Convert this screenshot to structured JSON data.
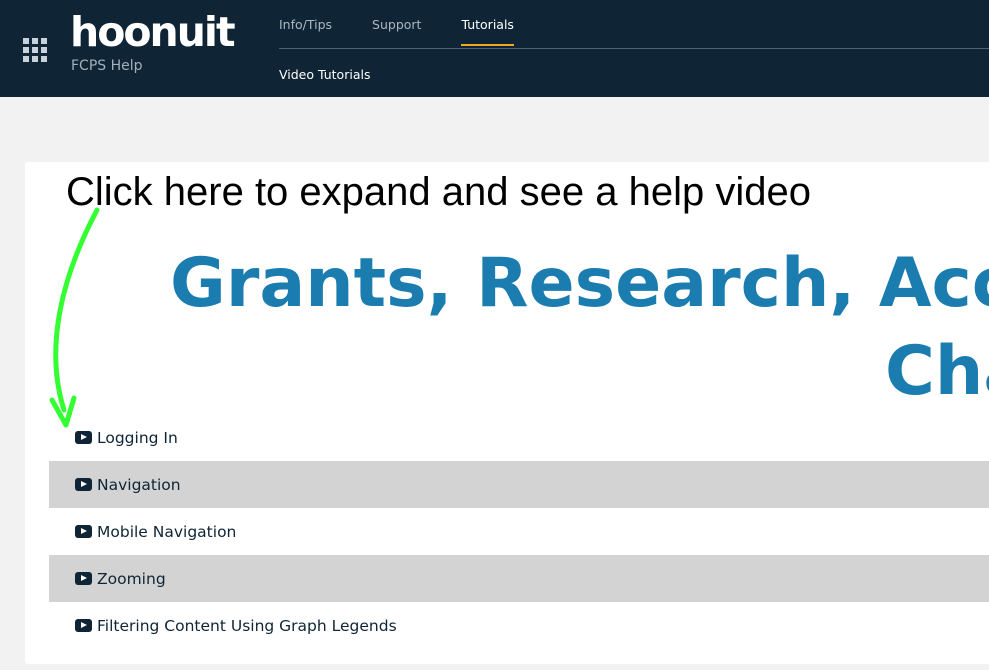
{
  "header": {
    "logo": "hoonuit",
    "subtitle": "FCPS Help",
    "nav": [
      {
        "label": "Info/Tips"
      },
      {
        "label": "Support"
      },
      {
        "label": "Tutorials"
      }
    ],
    "subnav": "Video Tutorials"
  },
  "annotation": {
    "text": "Click here to expand and see a help video",
    "arrow_color": "#33ff33"
  },
  "page": {
    "heading_line1": "Grants, Research, Accou",
    "heading_line2": "Cha"
  },
  "videos": [
    {
      "label": "Logging In"
    },
    {
      "label": "Navigation"
    },
    {
      "label": "Mobile Navigation"
    },
    {
      "label": "Zooming"
    },
    {
      "label": "Filtering Content Using Graph Legends"
    }
  ],
  "colors": {
    "header_bg": "#0f2535",
    "accent": "#f5a623",
    "heading": "#1b7cb0"
  }
}
